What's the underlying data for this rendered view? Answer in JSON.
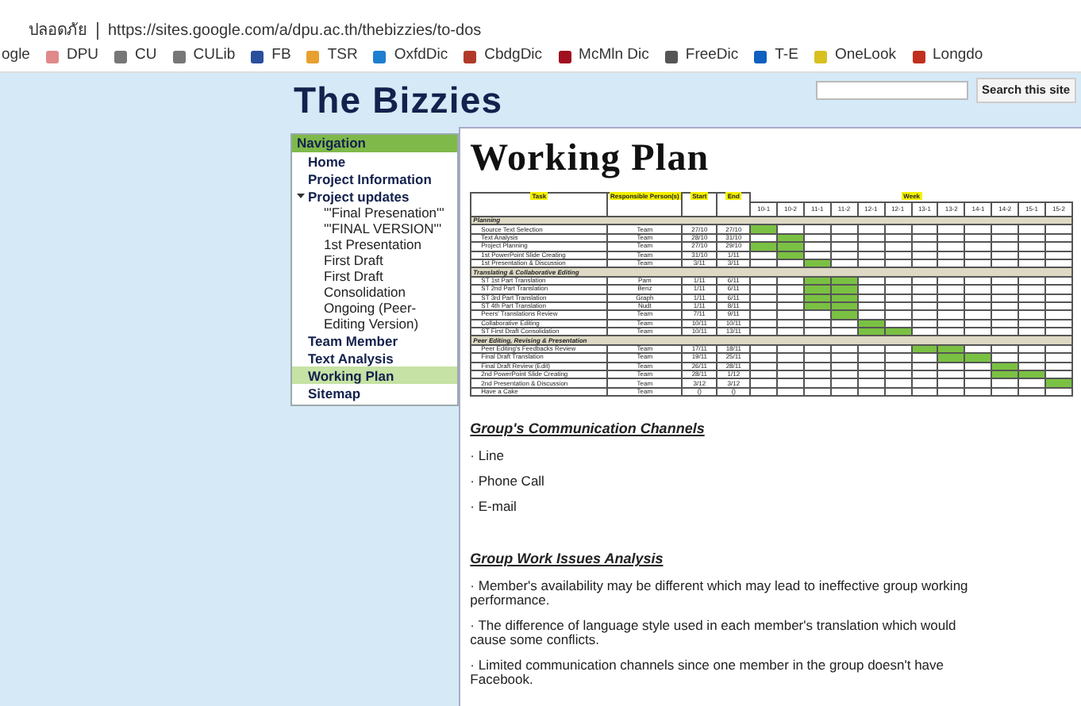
{
  "browser": {
    "security_label": "ปลอดภัย",
    "url": "https://sites.google.com/a/dpu.ac.th/thebizzies/to-dos",
    "bookmarks": [
      {
        "label": "ogle"
      },
      {
        "label": "DPU"
      },
      {
        "label": "CU"
      },
      {
        "label": "CULib"
      },
      {
        "label": "FB"
      },
      {
        "label": "TSR"
      },
      {
        "label": "OxfdDic"
      },
      {
        "label": "CbdgDic"
      },
      {
        "label": "McMln Dic"
      },
      {
        "label": "FreeDic"
      },
      {
        "label": "T-E"
      },
      {
        "label": "OneLook"
      },
      {
        "label": "Longdo"
      }
    ]
  },
  "site": {
    "title": "The Bizzies",
    "search": {
      "button": "Search this site"
    }
  },
  "navigation": {
    "title": "Navigation",
    "items": [
      {
        "label": "Home",
        "selected": false
      },
      {
        "label": "Project Information",
        "selected": false
      },
      {
        "label": "Project updates",
        "selected": false,
        "expanded": true,
        "children": [
          {
            "label": "'''Final Presenation'''",
            "selected": false
          },
          {
            "label": "'''FINAL VERSION'''",
            "selected": false
          },
          {
            "label": "1st Presentation",
            "selected": false
          },
          {
            "label": "First Draft",
            "selected": false
          },
          {
            "label": "First Draft Consolidation",
            "selected": false
          },
          {
            "label": "Ongoing (Peer-Editing Version)",
            "selected": false
          }
        ]
      },
      {
        "label": "Team Member",
        "selected": false
      },
      {
        "label": "Text Analysis",
        "selected": false
      },
      {
        "label": "Working Plan",
        "selected": true
      },
      {
        "label": "Sitemap",
        "selected": false
      }
    ]
  },
  "page": {
    "title": "Working Plan",
    "gantt": {
      "columns": [
        "Task",
        "Responsible Person(s)",
        "Start",
        "End"
      ],
      "week_label": "Week",
      "weeks": [
        "10-1",
        "10-2",
        "11-1",
        "11-2",
        "12-1",
        "12-1",
        "13-1",
        "13-2",
        "14-1",
        "14-2",
        "15-1",
        "15-2"
      ],
      "rows": [
        {
          "kind": "section",
          "task": "Planning"
        },
        {
          "kind": "task",
          "task": "Source Text Selection",
          "person": "Team",
          "start": "27/10",
          "end": "27/10",
          "active": [
            true,
            false,
            false,
            false,
            false,
            false,
            false,
            false,
            false,
            false,
            false,
            false
          ]
        },
        {
          "kind": "task",
          "task": "Text Analysis",
          "person": "Team",
          "start": "28/10",
          "end": "31/10",
          "active": [
            false,
            true,
            false,
            false,
            false,
            false,
            false,
            false,
            false,
            false,
            false,
            false
          ]
        },
        {
          "kind": "task",
          "task": "Project Planning",
          "person": "Team",
          "start": "27/10",
          "end": "29/10",
          "active": [
            true,
            true,
            false,
            false,
            false,
            false,
            false,
            false,
            false,
            false,
            false,
            false
          ]
        },
        {
          "kind": "task",
          "task": "1st PowerPoint Slide Creating",
          "person": "Team",
          "start": "31/10",
          "end": "1/11",
          "active": [
            false,
            true,
            false,
            false,
            false,
            false,
            false,
            false,
            false,
            false,
            false,
            false
          ]
        },
        {
          "kind": "task",
          "task": "1st Presentation & Discussion",
          "person": "Team",
          "start": "3/11",
          "end": "3/11",
          "active": [
            false,
            false,
            true,
            false,
            false,
            false,
            false,
            false,
            false,
            false,
            false,
            false
          ]
        },
        {
          "kind": "section",
          "task": "Translating & Collaborative Editing"
        },
        {
          "kind": "task",
          "task": "ST 1st Part Translation",
          "person": "Pam",
          "start": "1/11",
          "end": "6/11",
          "active": [
            false,
            false,
            true,
            true,
            false,
            false,
            false,
            false,
            false,
            false,
            false,
            false
          ]
        },
        {
          "kind": "task",
          "task": "ST 2nd Part Translation",
          "person": "Benz",
          "start": "1/11",
          "end": "6/11",
          "active": [
            false,
            false,
            true,
            true,
            false,
            false,
            false,
            false,
            false,
            false,
            false,
            false
          ]
        },
        {
          "kind": "task",
          "task": "ST 3rd Part Translation",
          "person": "Graph",
          "start": "1/11",
          "end": "6/11",
          "active": [
            false,
            false,
            true,
            true,
            false,
            false,
            false,
            false,
            false,
            false,
            false,
            false
          ]
        },
        {
          "kind": "task",
          "task": "ST 4th Part Translation",
          "person": "Nudt",
          "start": "1/11",
          "end": "8/11",
          "active": [
            false,
            false,
            true,
            true,
            false,
            false,
            false,
            false,
            false,
            false,
            false,
            false
          ]
        },
        {
          "kind": "task",
          "task": "Peers' Translations Review",
          "person": "Team",
          "start": "7/11",
          "end": "9/11",
          "active": [
            false,
            false,
            false,
            true,
            false,
            false,
            false,
            false,
            false,
            false,
            false,
            false
          ]
        },
        {
          "kind": "task",
          "task": "Collaborative Editing",
          "person": "Team",
          "start": "10/11",
          "end": "10/11",
          "active": [
            false,
            false,
            false,
            false,
            true,
            false,
            false,
            false,
            false,
            false,
            false,
            false
          ]
        },
        {
          "kind": "task",
          "task": "ST First Draft Consolidation",
          "person": "Team",
          "start": "10/11",
          "end": "13/11",
          "active": [
            false,
            false,
            false,
            false,
            true,
            true,
            false,
            false,
            false,
            false,
            false,
            false
          ]
        },
        {
          "kind": "section",
          "task": "Peer Editing, Revising & Presentation"
        },
        {
          "kind": "task",
          "task": "Peer Editing's Feedbacks Review",
          "person": "Team",
          "start": "17/11",
          "end": "18/11",
          "active": [
            false,
            false,
            false,
            false,
            false,
            false,
            true,
            true,
            false,
            false,
            false,
            false
          ]
        },
        {
          "kind": "task",
          "task": "Final Draft Translation",
          "person": "Team",
          "start": "19/11",
          "end": "25/11",
          "active": [
            false,
            false,
            false,
            false,
            false,
            false,
            false,
            true,
            true,
            false,
            false,
            false
          ]
        },
        {
          "kind": "task",
          "task": "Final Draft Review (Edit)",
          "person": "Team",
          "start": "26/11",
          "end": "28/11",
          "active": [
            false,
            false,
            false,
            false,
            false,
            false,
            false,
            false,
            false,
            true,
            false,
            false
          ]
        },
        {
          "kind": "task",
          "task": "2nd PowerPoint Slide Creating",
          "person": "Team",
          "start": "28/11",
          "end": "1/12",
          "active": [
            false,
            false,
            false,
            false,
            false,
            false,
            false,
            false,
            false,
            true,
            true,
            false
          ]
        },
        {
          "kind": "task",
          "task": "2nd Presentation & Discussion",
          "person": "Team",
          "start": "3/12",
          "end": "3/12",
          "active": [
            false,
            false,
            false,
            false,
            false,
            false,
            false,
            false,
            false,
            false,
            false,
            true
          ]
        },
        {
          "kind": "task",
          "task": "Have a Cake",
          "person": "Team",
          "start": "()",
          "end": "()",
          "active": [
            false,
            false,
            false,
            false,
            false,
            false,
            false,
            false,
            false,
            false,
            false,
            false
          ]
        }
      ]
    },
    "sections": [
      {
        "heading": "Group's Communication Channels",
        "items": [
          "· Line",
          "· Phone Call",
          "· E-mail"
        ]
      },
      {
        "heading": "Group Work Issues Analysis",
        "items": [
          "· Member's availability may be different which may lead to ineffective group working performance.",
          "· The difference of language style used in each member's translation which would cause some conflicts.",
          "· Limited communication channels since one member in the group doesn't have Facebook."
        ]
      }
    ]
  }
}
